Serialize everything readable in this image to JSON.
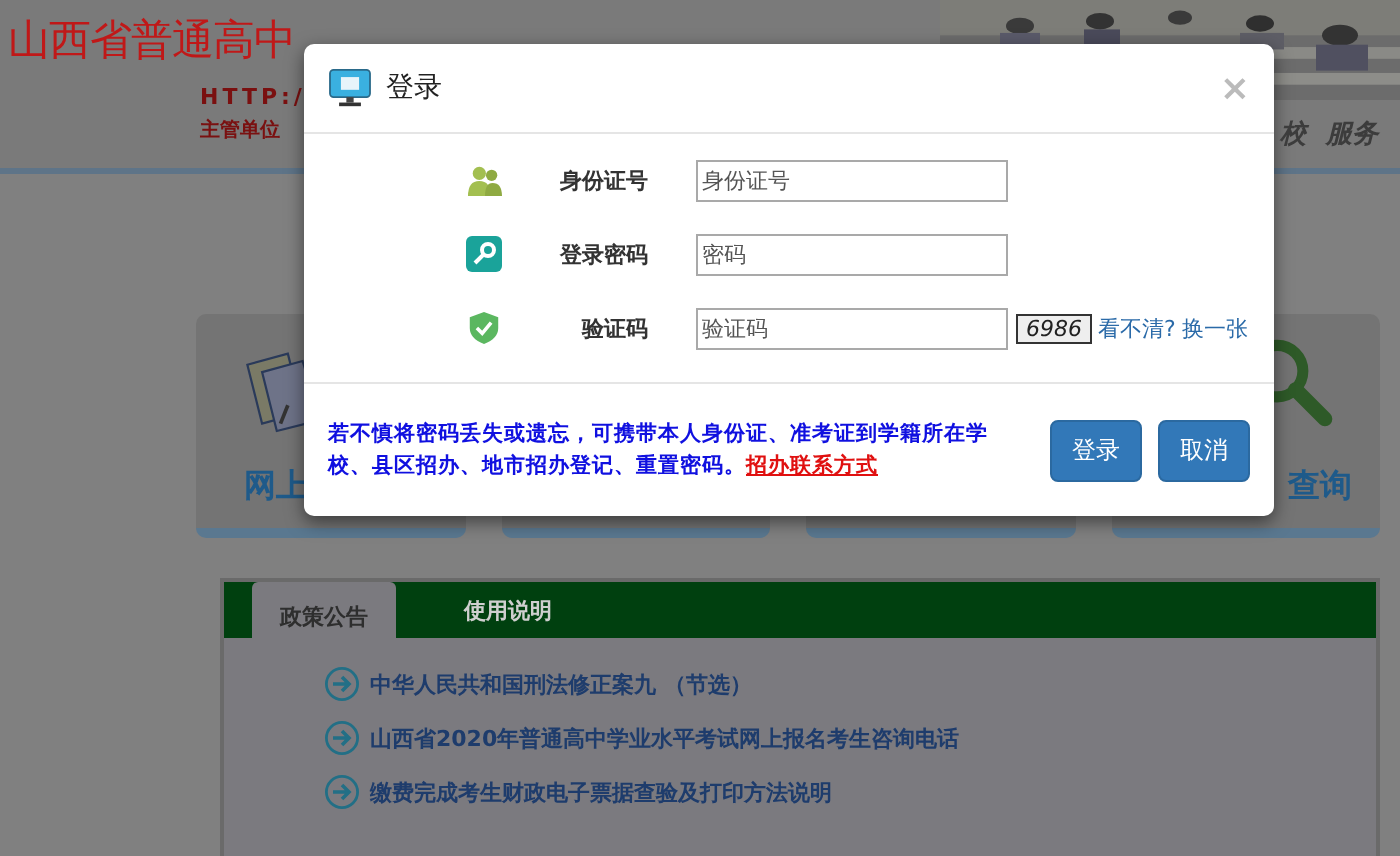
{
  "header": {
    "site_title": "山西省普通高中",
    "url_text": "HTTP:/",
    "authority_label": "主管单位",
    "nav_items": [
      "校",
      "服务"
    ]
  },
  "cards": [
    {
      "kind": "documents",
      "label": "网上"
    },
    {
      "kind": "blank"
    },
    {
      "kind": "blank"
    },
    {
      "kind": "search",
      "label": "查询"
    }
  ],
  "notice_panel": {
    "tabs": [
      {
        "label": "政策公告",
        "selected": true
      },
      {
        "label": "使用说明",
        "selected": false
      }
    ],
    "items": [
      "中华人民共和国刑法修正案九 （节选）",
      "山西省2020年普通高中学业水平考试网上报名考生咨询电话",
      "缴费完成考生财政电子票据查验及打印方法说明"
    ]
  },
  "dialog": {
    "title": "登录",
    "close": "×",
    "fields": [
      {
        "kind": "person",
        "label": "身份证号",
        "placeholder": "身份证号"
      },
      {
        "kind": "key",
        "label": "登录密码",
        "placeholder": "密码"
      },
      {
        "kind": "captcha",
        "label": "验证码",
        "placeholder": "验证码"
      }
    ],
    "captcha_code": "6986",
    "captcha_links": [
      "看不清?",
      "换一张"
    ],
    "note": "若不慎将密码丢失或遗忘，可携带本人身份证、准考证到学籍所在学校、县区招办、地市招办登记、重置密码。",
    "note_link": "招办联系方式",
    "buttons": [
      "登录",
      "取消"
    ]
  }
}
